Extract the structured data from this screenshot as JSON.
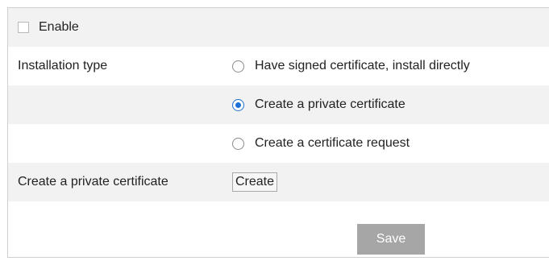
{
  "enable": {
    "label": "Enable",
    "checked": false
  },
  "installation": {
    "label": "Installation type",
    "options": [
      {
        "label": "Have signed certificate, install directly",
        "checked": false
      },
      {
        "label": "Create a private certificate",
        "checked": true
      },
      {
        "label": "Create a certificate request",
        "checked": false
      }
    ]
  },
  "private_cert": {
    "label": "Create a private certificate",
    "button_label": "Create"
  },
  "save_label": "Save",
  "colors": {
    "accent": "#1e6fd6",
    "row_shade": "#f2f2f2",
    "save_bg": "#a6a6a6"
  }
}
